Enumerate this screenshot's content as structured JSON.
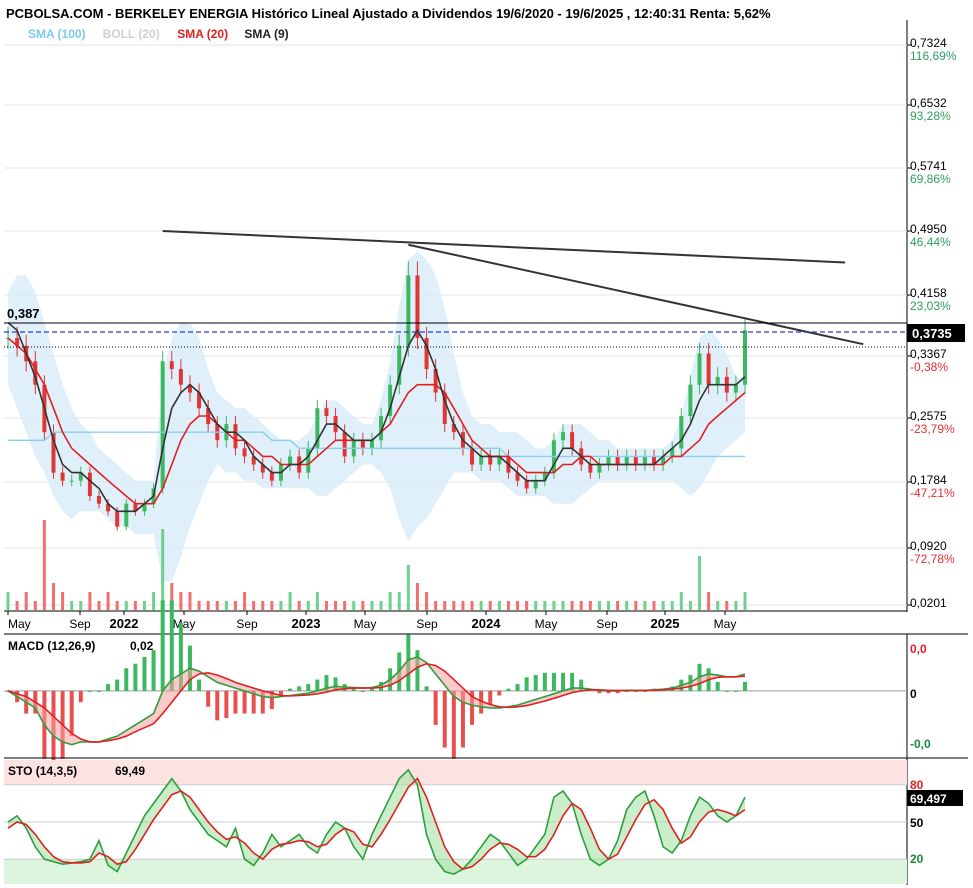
{
  "header": {
    "title": "PCBOLSA.COM - BERKELEY ENERGIA Histórico Lineal Ajustado a Dividendos 19/6/2020 - 19/6/2025 , 12:40:31 Renta: 5,62%",
    "legend": [
      {
        "label": "SMA (100)",
        "color": "#7ec8f0"
      },
      {
        "label": "BOLL (20)",
        "color": "#d0d0d0"
      },
      {
        "label": "SMA (20)",
        "color": "#e02020"
      },
      {
        "label": "SMA (9)",
        "color": "#222222"
      }
    ]
  },
  "chart_data": [
    {
      "type": "line",
      "panel": "price",
      "y_ticks": [
        {
          "value": "0,7324",
          "pct": "116,69%",
          "pct_color": "#2e9e5e"
        },
        {
          "value": "0,6532",
          "pct": "93,28%",
          "pct_color": "#2e9e5e"
        },
        {
          "value": "0,5741",
          "pct": "69,86%",
          "pct_color": "#2e9e5e"
        },
        {
          "value": "0,4950",
          "pct": "46,44%",
          "pct_color": "#2e9e5e"
        },
        {
          "value": "0,4158",
          "pct": "23,03%",
          "pct_color": "#2e9e5e"
        },
        {
          "value": "0,3367",
          "pct": "-0,38%",
          "pct_color": "#e03030"
        },
        {
          "value": "0,2575",
          "pct": "-23,79%",
          "pct_color": "#e03030"
        },
        {
          "value": "0,1784",
          "pct": "-47,21%",
          "pct_color": "#e03030"
        },
        {
          "value": "0,0920",
          "pct": "-72,78%",
          "pct_color": "#e03030"
        },
        {
          "value": "0,0201",
          "pct": "",
          "pct_color": "#e03030"
        }
      ],
      "x_ticks": [
        "May",
        "Sep",
        "2022",
        "May",
        "Sep",
        "2023",
        "May",
        "Sep",
        "2024",
        "May",
        "Sep",
        "2025",
        "May"
      ],
      "last_price_label": "0,3735",
      "start_price_label": "0,387",
      "ylim": [
        0.0201,
        0.7324
      ],
      "price": [
        0.36,
        0.35,
        0.33,
        0.3,
        0.24,
        0.19,
        0.18,
        0.18,
        0.19,
        0.16,
        0.15,
        0.14,
        0.12,
        0.15,
        0.14,
        0.15,
        0.17,
        0.33,
        0.32,
        0.3,
        0.29,
        0.27,
        0.25,
        0.23,
        0.25,
        0.22,
        0.21,
        0.2,
        0.19,
        0.18,
        0.2,
        0.21,
        0.19,
        0.22,
        0.27,
        0.26,
        0.24,
        0.21,
        0.23,
        0.22,
        0.23,
        0.26,
        0.3,
        0.35,
        0.44,
        0.36,
        0.32,
        0.29,
        0.25,
        0.24,
        0.22,
        0.2,
        0.21,
        0.2,
        0.21,
        0.19,
        0.18,
        0.17,
        0.18,
        0.19,
        0.23,
        0.24,
        0.22,
        0.2,
        0.19,
        0.2,
        0.21,
        0.2,
        0.21,
        0.2,
        0.21,
        0.2,
        0.21,
        0.22,
        0.26,
        0.3,
        0.34,
        0.3,
        0.31,
        0.29,
        0.3,
        0.37
      ],
      "sma9": [
        0.38,
        0.37,
        0.34,
        0.31,
        0.27,
        0.23,
        0.2,
        0.19,
        0.19,
        0.18,
        0.17,
        0.15,
        0.14,
        0.14,
        0.14,
        0.15,
        0.16,
        0.22,
        0.27,
        0.29,
        0.3,
        0.29,
        0.27,
        0.25,
        0.24,
        0.24,
        0.23,
        0.21,
        0.2,
        0.19,
        0.19,
        0.2,
        0.2,
        0.21,
        0.23,
        0.25,
        0.25,
        0.24,
        0.23,
        0.23,
        0.23,
        0.24,
        0.27,
        0.31,
        0.35,
        0.37,
        0.35,
        0.32,
        0.28,
        0.25,
        0.23,
        0.22,
        0.21,
        0.21,
        0.21,
        0.2,
        0.19,
        0.18,
        0.18,
        0.18,
        0.2,
        0.22,
        0.22,
        0.21,
        0.2,
        0.2,
        0.2,
        0.2,
        0.2,
        0.2,
        0.2,
        0.2,
        0.21,
        0.22,
        0.23,
        0.25,
        0.28,
        0.3,
        0.3,
        0.3,
        0.3,
        0.31
      ],
      "sma20": [
        0.36,
        0.35,
        0.34,
        0.32,
        0.3,
        0.27,
        0.24,
        0.22,
        0.21,
        0.2,
        0.19,
        0.18,
        0.17,
        0.16,
        0.15,
        0.15,
        0.15,
        0.17,
        0.2,
        0.23,
        0.25,
        0.26,
        0.26,
        0.25,
        0.24,
        0.23,
        0.23,
        0.22,
        0.21,
        0.21,
        0.2,
        0.2,
        0.2,
        0.2,
        0.21,
        0.22,
        0.23,
        0.23,
        0.23,
        0.23,
        0.23,
        0.24,
        0.25,
        0.27,
        0.29,
        0.3,
        0.3,
        0.3,
        0.29,
        0.27,
        0.25,
        0.23,
        0.22,
        0.21,
        0.21,
        0.21,
        0.2,
        0.19,
        0.19,
        0.19,
        0.19,
        0.2,
        0.2,
        0.21,
        0.21,
        0.2,
        0.2,
        0.2,
        0.2,
        0.2,
        0.2,
        0.2,
        0.2,
        0.21,
        0.21,
        0.22,
        0.23,
        0.25,
        0.26,
        0.27,
        0.28,
        0.29
      ],
      "sma100": [
        0.23,
        0.23,
        0.23,
        0.23,
        0.23,
        0.24,
        0.24,
        0.24,
        0.24,
        0.24,
        0.24,
        0.24,
        0.24,
        0.24,
        0.24,
        0.24,
        0.24,
        0.24,
        0.24,
        0.24,
        0.24,
        0.24,
        0.24,
        0.24,
        0.24,
        0.24,
        0.24,
        0.24,
        0.24,
        0.23,
        0.23,
        0.23,
        0.22,
        0.22,
        0.22,
        0.22,
        0.22,
        0.22,
        0.22,
        0.22,
        0.22,
        0.22,
        0.22,
        0.22,
        0.22,
        0.22,
        0.22,
        0.22,
        0.22,
        0.22,
        0.22,
        0.22,
        0.22,
        0.22,
        0.22,
        0.21,
        0.21,
        0.21,
        0.21,
        0.21,
        0.21,
        0.21,
        0.21,
        0.21,
        0.21,
        0.21,
        0.21,
        0.21,
        0.21,
        0.21,
        0.21,
        0.21,
        0.21,
        0.21,
        0.21,
        0.21,
        0.21,
        0.21,
        0.21,
        0.21,
        0.21,
        0.21
      ],
      "boll_upper": [
        0.42,
        0.44,
        0.44,
        0.42,
        0.38,
        0.34,
        0.3,
        0.27,
        0.25,
        0.24,
        0.22,
        0.21,
        0.2,
        0.19,
        0.18,
        0.18,
        0.18,
        0.31,
        0.36,
        0.38,
        0.38,
        0.36,
        0.32,
        0.29,
        0.28,
        0.27,
        0.27,
        0.26,
        0.25,
        0.24,
        0.23,
        0.23,
        0.23,
        0.24,
        0.26,
        0.28,
        0.28,
        0.27,
        0.26,
        0.25,
        0.25,
        0.28,
        0.33,
        0.4,
        0.46,
        0.47,
        0.46,
        0.44,
        0.4,
        0.34,
        0.29,
        0.26,
        0.25,
        0.25,
        0.24,
        0.24,
        0.24,
        0.23,
        0.22,
        0.22,
        0.23,
        0.25,
        0.25,
        0.25,
        0.24,
        0.23,
        0.23,
        0.22,
        0.22,
        0.22,
        0.22,
        0.22,
        0.22,
        0.23,
        0.26,
        0.31,
        0.36,
        0.37,
        0.36,
        0.34,
        0.31,
        0.31
      ],
      "boll_lower": [
        0.3,
        0.27,
        0.24,
        0.21,
        0.19,
        0.16,
        0.14,
        0.13,
        0.14,
        0.14,
        0.14,
        0.13,
        0.12,
        0.12,
        0.11,
        0.11,
        0.11,
        0.05,
        0.05,
        0.08,
        0.12,
        0.15,
        0.18,
        0.2,
        0.19,
        0.19,
        0.18,
        0.18,
        0.17,
        0.17,
        0.17,
        0.17,
        0.17,
        0.17,
        0.16,
        0.16,
        0.17,
        0.18,
        0.19,
        0.2,
        0.2,
        0.19,
        0.17,
        0.13,
        0.1,
        0.12,
        0.13,
        0.15,
        0.17,
        0.19,
        0.19,
        0.19,
        0.18,
        0.18,
        0.18,
        0.17,
        0.16,
        0.16,
        0.16,
        0.16,
        0.15,
        0.15,
        0.15,
        0.16,
        0.17,
        0.18,
        0.18,
        0.18,
        0.18,
        0.18,
        0.18,
        0.18,
        0.18,
        0.18,
        0.17,
        0.16,
        0.17,
        0.19,
        0.21,
        0.22,
        0.23,
        0.24
      ],
      "volume": [
        0.2,
        0.1,
        0.2,
        0.1,
        1.0,
        0.3,
        0.2,
        0.1,
        0.1,
        0.2,
        0.1,
        0.2,
        0.1,
        0.1,
        0.1,
        0.1,
        0.2,
        0.9,
        0.3,
        0.2,
        0.2,
        0.1,
        0.1,
        0.1,
        0.1,
        0.1,
        0.2,
        0.1,
        0.1,
        0.1,
        0.1,
        0.2,
        0.1,
        0.1,
        0.2,
        0.1,
        0.1,
        0.1,
        0.1,
        0.1,
        0.1,
        0.1,
        0.2,
        0.2,
        0.5,
        0.3,
        0.2,
        0.1,
        0.1,
        0.1,
        0.1,
        0.1,
        0.1,
        0.1,
        0.1,
        0.1,
        0.1,
        0.1,
        0.1,
        0.1,
        0.1,
        0.1,
        0.1,
        0.1,
        0.1,
        0.1,
        0.1,
        0.1,
        0.1,
        0.1,
        0.1,
        0.1,
        0.1,
        0.1,
        0.2,
        0.1,
        0.6,
        0.2,
        0.1,
        0.1,
        0.1,
        0.2
      ],
      "trendlines": [
        {
          "from": [
            17,
            0.495
          ],
          "to": [
            92,
            0.456
          ]
        },
        {
          "from": [
            44,
            0.478
          ],
          "to": [
            94,
            0.352
          ]
        }
      ]
    },
    {
      "type": "bar",
      "panel": "macd",
      "title": "MACD (12,26,9)",
      "value_label": "0,02",
      "y_labels": [
        "0,0",
        "0",
        "-0,0"
      ],
      "macd": [
        0.0,
        -0.01,
        -0.02,
        -0.03,
        -0.06,
        -0.08,
        -0.09,
        -0.095,
        -0.09,
        -0.09,
        -0.09,
        -0.085,
        -0.08,
        -0.07,
        -0.06,
        -0.05,
        -0.04,
        0.0,
        0.02,
        0.03,
        0.04,
        0.035,
        0.025,
        0.015,
        0.01,
        0.005,
        0.0,
        -0.005,
        -0.01,
        -0.012,
        -0.01,
        -0.008,
        -0.006,
        -0.004,
        0.0,
        0.005,
        0.008,
        0.007,
        0.006,
        0.005,
        0.006,
        0.01,
        0.02,
        0.035,
        0.055,
        0.06,
        0.05,
        0.03,
        0.01,
        -0.01,
        -0.02,
        -0.025,
        -0.028,
        -0.03,
        -0.03,
        -0.028,
        -0.025,
        -0.02,
        -0.015,
        -0.01,
        -0.005,
        0.0,
        0.005,
        0.005,
        0.003,
        0.001,
        0.0,
        0.0,
        0.001,
        0.001,
        0.001,
        0.002,
        0.003,
        0.005,
        0.01,
        0.015,
        0.025,
        0.03,
        0.028,
        0.025,
        0.025,
        0.03
      ],
      "signal": [
        0.0,
        -0.005,
        -0.01,
        -0.02,
        -0.03,
        -0.045,
        -0.06,
        -0.075,
        -0.085,
        -0.09,
        -0.09,
        -0.088,
        -0.085,
        -0.08,
        -0.072,
        -0.065,
        -0.058,
        -0.04,
        -0.02,
        0.0,
        0.02,
        0.03,
        0.032,
        0.028,
        0.022,
        0.015,
        0.01,
        0.005,
        0.0,
        -0.004,
        -0.008,
        -0.009,
        -0.008,
        -0.007,
        -0.005,
        -0.002,
        0.002,
        0.004,
        0.005,
        0.005,
        0.005,
        0.006,
        0.01,
        0.018,
        0.03,
        0.042,
        0.048,
        0.045,
        0.035,
        0.02,
        0.005,
        -0.01,
        -0.018,
        -0.024,
        -0.028,
        -0.029,
        -0.028,
        -0.026,
        -0.022,
        -0.018,
        -0.013,
        -0.008,
        -0.003,
        0.0,
        0.002,
        0.002,
        0.001,
        0.001,
        0.001,
        0.001,
        0.001,
        0.001,
        0.002,
        0.003,
        0.005,
        0.008,
        0.013,
        0.02,
        0.024,
        0.025,
        0.025,
        0.026
      ],
      "ylim": [
        -0.115,
        0.09
      ]
    },
    {
      "type": "line",
      "panel": "sto",
      "title": "STO (14,3,5)",
      "value_label": "69,49",
      "last_value_label": "69,497",
      "y_labels": [
        "80",
        "50",
        "20"
      ],
      "k": [
        50,
        55,
        45,
        30,
        20,
        18,
        16,
        17,
        18,
        20,
        35,
        15,
        10,
        25,
        40,
        55,
        65,
        75,
        85,
        75,
        60,
        50,
        40,
        35,
        30,
        45,
        20,
        15,
        25,
        40,
        30,
        35,
        40,
        30,
        25,
        40,
        50,
        45,
        30,
        20,
        40,
        55,
        70,
        85,
        92,
        80,
        40,
        20,
        10,
        8,
        12,
        20,
        30,
        40,
        35,
        25,
        15,
        20,
        30,
        40,
        70,
        75,
        65,
        40,
        20,
        15,
        20,
        35,
        60,
        70,
        75,
        55,
        30,
        25,
        35,
        55,
        70,
        65,
        55,
        50,
        55,
        70
      ],
      "d": [
        45,
        50,
        48,
        40,
        30,
        22,
        18,
        17,
        17,
        18,
        25,
        22,
        16,
        18,
        28,
        40,
        52,
        62,
        72,
        75,
        70,
        60,
        50,
        42,
        36,
        38,
        33,
        25,
        20,
        28,
        32,
        33,
        35,
        34,
        30,
        32,
        40,
        45,
        42,
        32,
        30,
        40,
        52,
        65,
        78,
        85,
        70,
        50,
        30,
        18,
        12,
        14,
        20,
        28,
        33,
        32,
        28,
        22,
        22,
        28,
        40,
        55,
        65,
        60,
        45,
        28,
        20,
        24,
        38,
        52,
        64,
        68,
        60,
        45,
        33,
        38,
        50,
        58,
        60,
        58,
        55,
        60
      ],
      "levels": [
        80,
        50,
        20
      ],
      "ylim": [
        0,
        100
      ]
    }
  ]
}
